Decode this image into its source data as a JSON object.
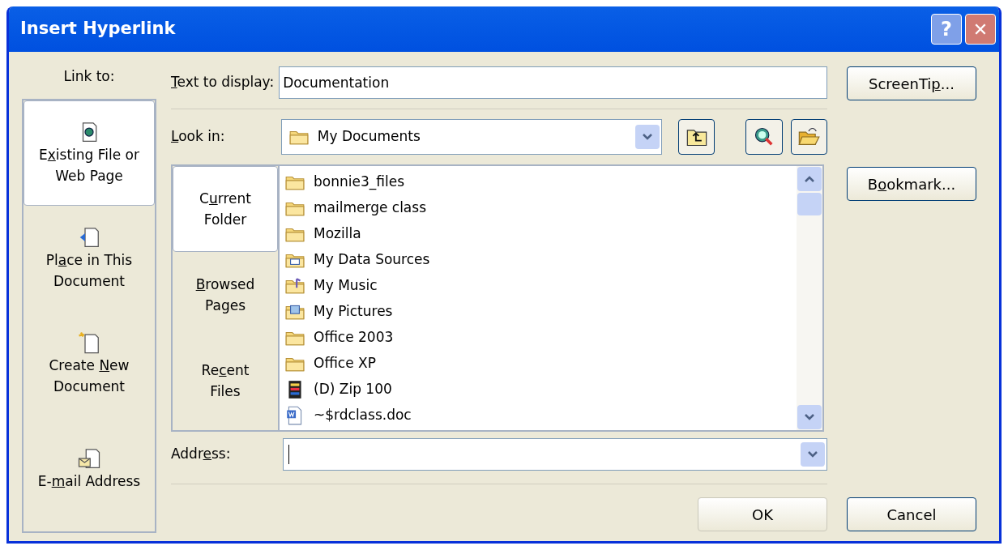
{
  "window": {
    "title": "Insert Hyperlink",
    "help": "?",
    "close": "✕"
  },
  "link_to": {
    "label": "Link to:",
    "items": [
      {
        "kind": "web",
        "label_parts": {
          "pre": "E",
          "key": "x",
          "post": "isting File or Web Page"
        },
        "selected": true
      },
      {
        "kind": "place",
        "label_parts": {
          "pre": "Pl",
          "key": "a",
          "post": "ce in This Document"
        },
        "selected": false
      },
      {
        "kind": "new",
        "label_parts": {
          "pre": "Create ",
          "key": "N",
          "post": "ew Document"
        },
        "selected": false
      },
      {
        "kind": "email",
        "label_parts": {
          "pre": "E-",
          "key": "m",
          "post": "ail Address"
        },
        "selected": false
      }
    ]
  },
  "text_to_display": {
    "label_parts": {
      "key": "T",
      "post": "ext to display:"
    },
    "value": "Documentation"
  },
  "look_in": {
    "label_parts": {
      "key": "L",
      "post": "ook in:"
    },
    "value": "My Documents"
  },
  "views": [
    {
      "label_parts": {
        "pre": "C",
        "key": "u",
        "post": "rrent Folder"
      },
      "selected": true
    },
    {
      "label_parts": {
        "key": "B",
        "post": "rowsed Pages"
      },
      "selected": false
    },
    {
      "label_parts": {
        "pre": "Re",
        "key": "c",
        "post": "ent Files"
      },
      "selected": false
    }
  ],
  "files": [
    {
      "kind": "folder",
      "name": "bonnie3_files"
    },
    {
      "kind": "folder",
      "name": "mailmerge class"
    },
    {
      "kind": "folder",
      "name": "Mozilla"
    },
    {
      "kind": "data",
      "name": "My Data Sources"
    },
    {
      "kind": "music",
      "name": "My Music"
    },
    {
      "kind": "pictures",
      "name": "My Pictures"
    },
    {
      "kind": "folder",
      "name": "Office 2003"
    },
    {
      "kind": "folder",
      "name": "Office XP"
    },
    {
      "kind": "drive",
      "name": "(D) Zip 100"
    },
    {
      "kind": "doc",
      "name": "~$rdclass.doc"
    }
  ],
  "address": {
    "label_parts": {
      "pre": "Addr",
      "key": "e",
      "post": "ss:"
    }
  },
  "buttons": {
    "screentip": {
      "label_parts": {
        "pre": "ScreenTi",
        "key": "p",
        "post": "..."
      }
    },
    "bookmark": {
      "label_parts": {
        "pre": "B",
        "key": "o",
        "post": "okmark..."
      }
    },
    "ok": {
      "label": "OK",
      "disabled": true
    },
    "cancel": {
      "label": "Cancel",
      "disabled": false
    }
  }
}
